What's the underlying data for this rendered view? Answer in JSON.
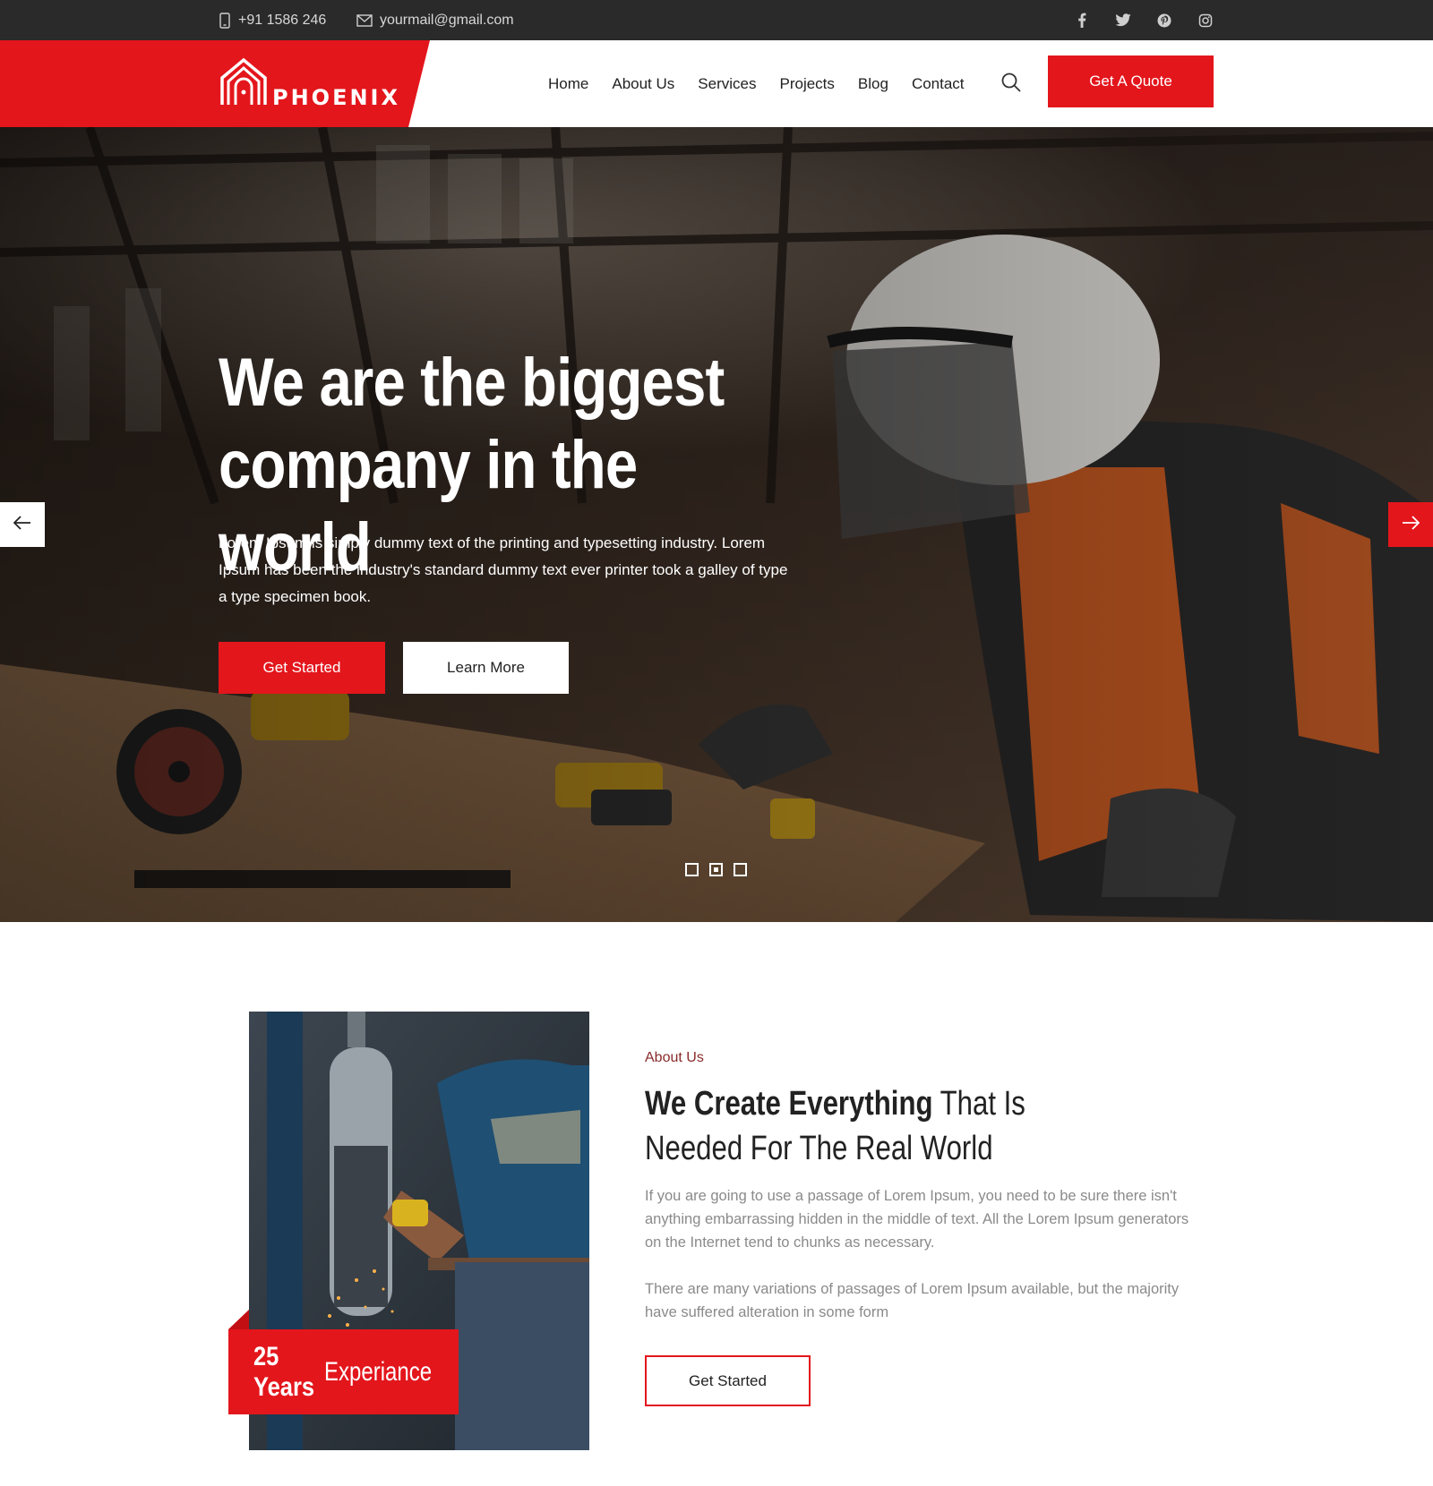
{
  "topbar": {
    "phone": "+91 1586 246",
    "email": "yourmail@gmail.com",
    "social": [
      "facebook-icon",
      "twitter-icon",
      "pinterest-icon",
      "instagram-icon"
    ]
  },
  "brand": {
    "logo_text": "PHOENIX",
    "accent_color": "#e3161c"
  },
  "nav": {
    "items": [
      "Home",
      "About Us",
      "Services",
      "Projects",
      "Blog",
      "Contact"
    ],
    "cta": "Get A Quote"
  },
  "hero": {
    "title_line1": "We are the biggest",
    "title_line2": "company in the world",
    "text": "Lorem Ipsum is simply dummy text of the printing and typesetting industry. Lorem Ipsum has been the industry's standard dummy text ever printer took a galley of type a type specimen book.",
    "primary_button": "Get Started",
    "secondary_button": "Learn More",
    "slides_total": 3,
    "active_slide": 2
  },
  "about": {
    "label": "About Us",
    "title_strong": "We Create Everything",
    "title_rest": "That Is Needed For The Real World",
    "paragraph1": "If you are going to use a passage of Lorem Ipsum, you need to be sure there isn't anything embarrassing hidden in the middle of text. All the Lorem Ipsum generators on the Internet tend to chunks as necessary.",
    "paragraph2": "There are many variations of passages of Lorem Ipsum available, but the majority have suffered alteration in some form",
    "button": "Get Started",
    "experience_strong": "25 Years",
    "experience_light": "Experiance"
  }
}
